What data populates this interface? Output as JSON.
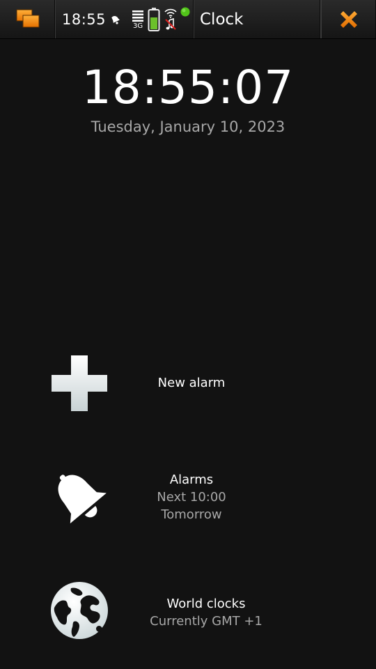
{
  "status_bar": {
    "time": "18:55",
    "network_type": "3G",
    "icons": [
      "task-switcher-icon",
      "alarm-set-icon",
      "signal-strength-icon",
      "battery-icon",
      "wifi-icon",
      "music-muted-icon",
      "presence-online-icon",
      "close-icon"
    ]
  },
  "app": {
    "title": "Clock"
  },
  "clock": {
    "time": "18:55:07",
    "date": "Tuesday, January 10, 2023"
  },
  "items": {
    "new_alarm": {
      "label": "New alarm",
      "icon": "plus-icon"
    },
    "alarms": {
      "label": "Alarms",
      "next": "Next 10:00",
      "day": "Tomorrow",
      "icon": "bell-icon"
    },
    "world_clocks": {
      "label": "World clocks",
      "subtitle": "Currently GMT +1",
      "icon": "globe-icon"
    }
  },
  "colors": {
    "background": "#121212",
    "accent": "#f08a00",
    "secondary_text": "#a8a8a8",
    "battery_fill": "#6cc12a",
    "presence": "#52c41a"
  }
}
